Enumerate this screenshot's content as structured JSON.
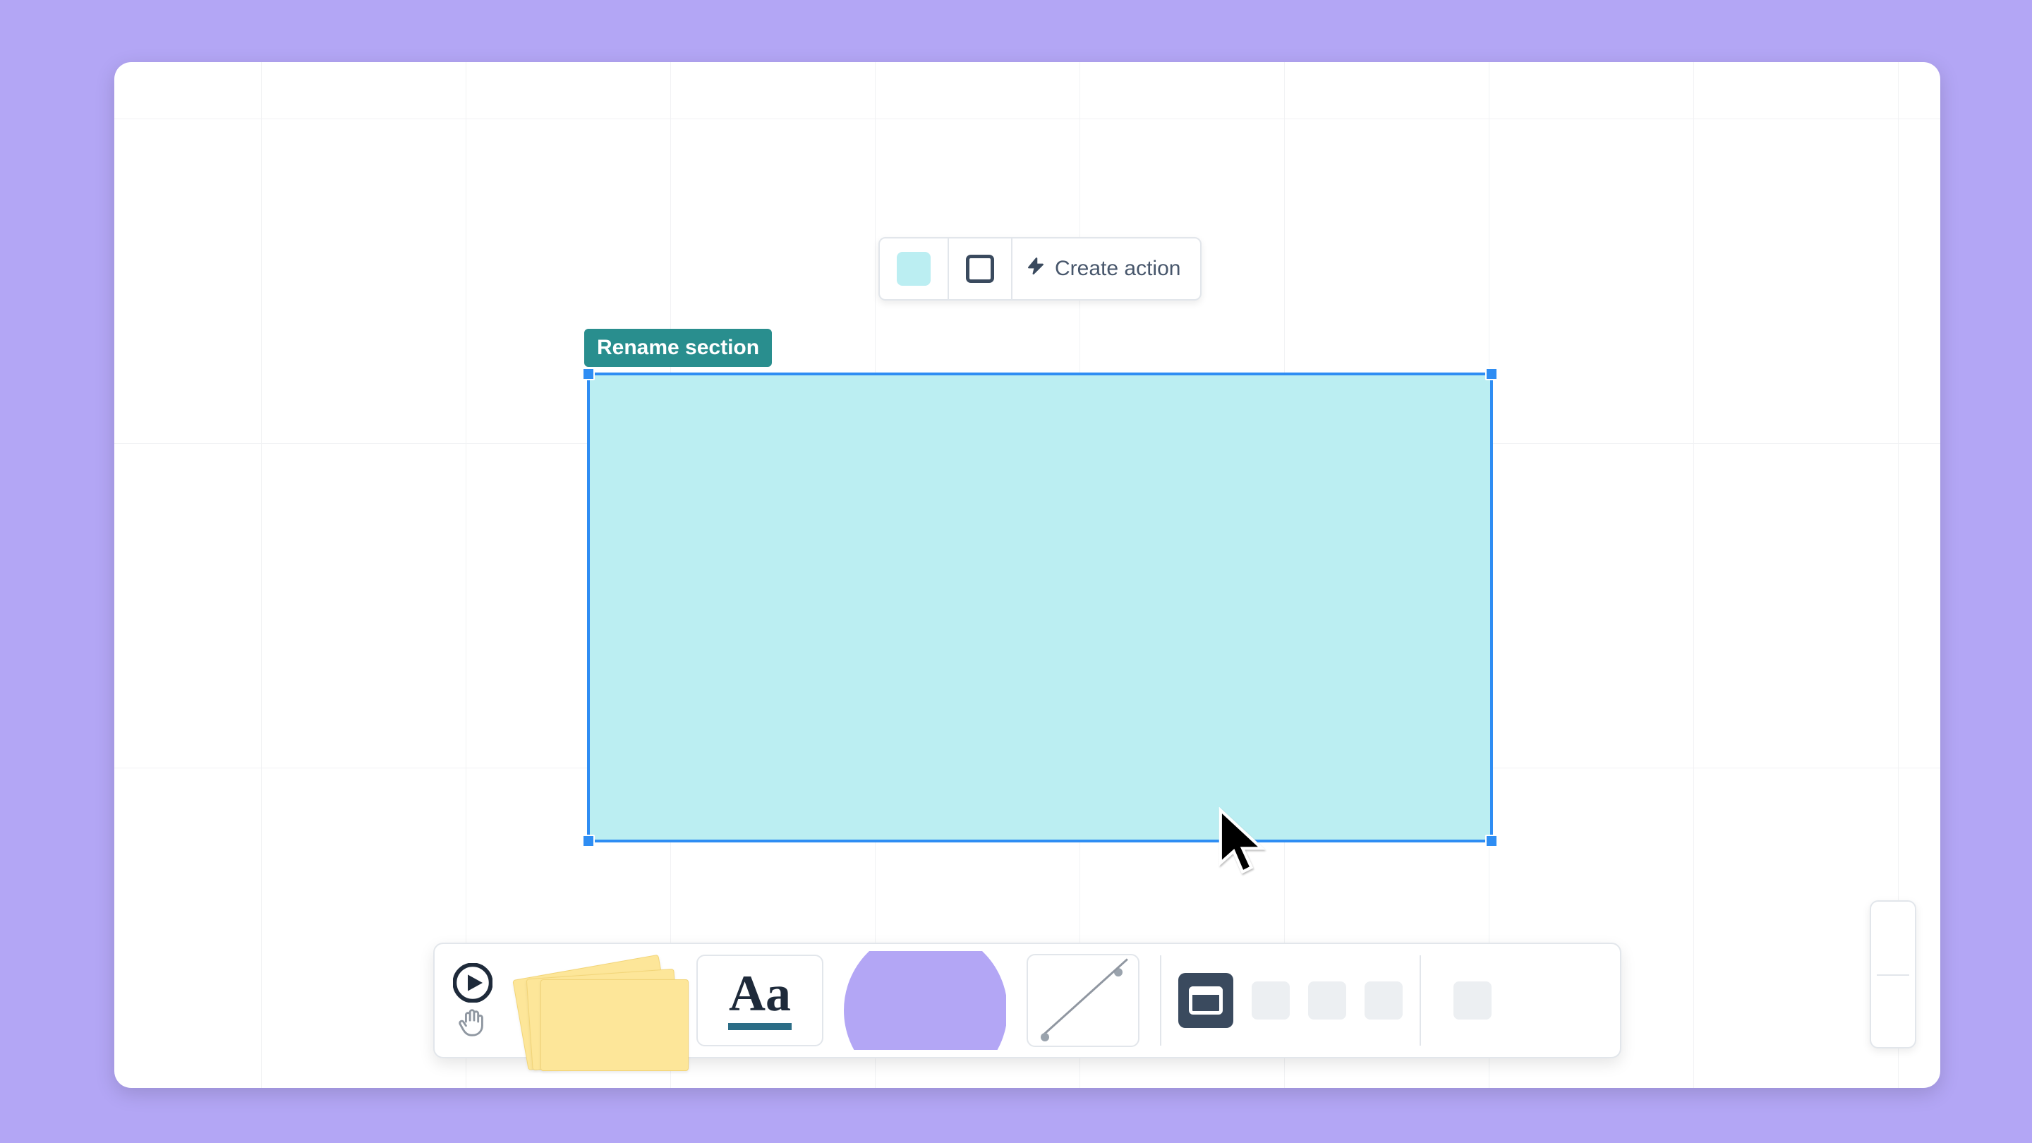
{
  "tooltip": {
    "rename_label": "Rename section"
  },
  "context_bar": {
    "fill_color": "#bbeef2",
    "create_action_label": "Create action"
  },
  "text_tool": {
    "glyph": "Aa"
  },
  "dock": {
    "section_active": true
  }
}
